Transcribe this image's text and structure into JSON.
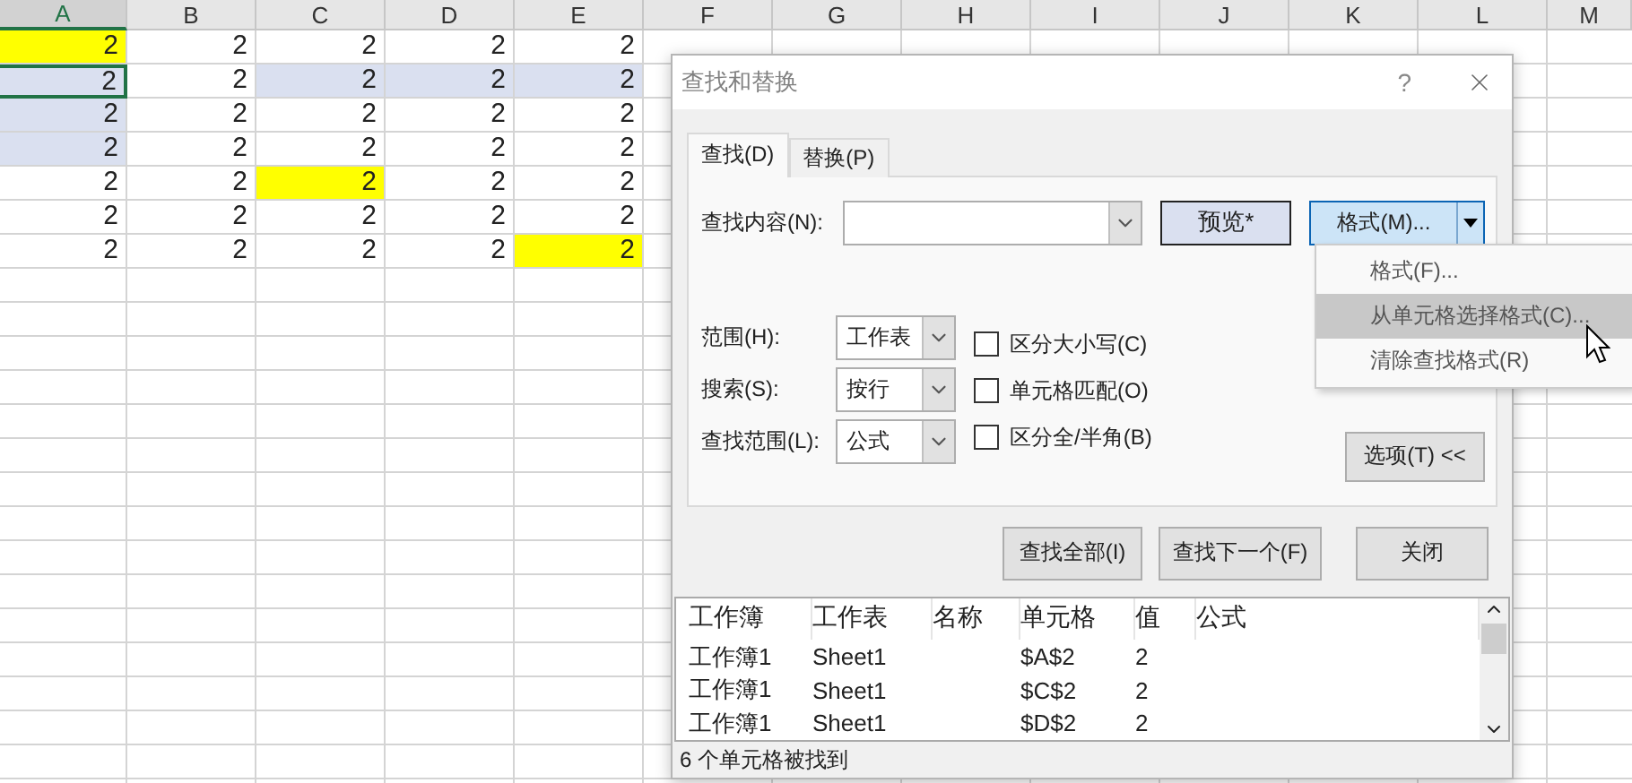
{
  "sheet": {
    "columns": [
      {
        "label": "A",
        "selected": true
      },
      {
        "label": "B",
        "selected": false
      },
      {
        "label": "C",
        "selected": false
      },
      {
        "label": "D",
        "selected": false
      },
      {
        "label": "E",
        "selected": false
      },
      {
        "label": "F",
        "selected": false
      },
      {
        "label": "G",
        "selected": false
      },
      {
        "label": "H",
        "selected": false
      },
      {
        "label": "I",
        "selected": false
      },
      {
        "label": "J",
        "selected": false
      },
      {
        "label": "K",
        "selected": false
      },
      {
        "label": "L",
        "selected": false
      },
      {
        "label": "M",
        "selected": false
      }
    ],
    "rows": [
      {
        "cells": [
          {
            "value": "2",
            "highlighted": true,
            "selected": false,
            "active": false
          },
          {
            "value": "2",
            "highlighted": false,
            "selected": false,
            "active": false
          },
          {
            "value": "2",
            "highlighted": false,
            "selected": false,
            "active": false
          },
          {
            "value": "2",
            "highlighted": false,
            "selected": false,
            "active": false
          },
          {
            "value": "2",
            "highlighted": false,
            "selected": false,
            "active": false
          }
        ]
      },
      {
        "cells": [
          {
            "value": "2",
            "highlighted": false,
            "selected": true,
            "active": true
          },
          {
            "value": "2",
            "highlighted": false,
            "selected": false,
            "active": false
          },
          {
            "value": "2",
            "highlighted": false,
            "selected": true,
            "active": false
          },
          {
            "value": "2",
            "highlighted": false,
            "selected": true,
            "active": false
          },
          {
            "value": "2",
            "highlighted": false,
            "selected": true,
            "active": false
          }
        ]
      },
      {
        "cells": [
          {
            "value": "2",
            "highlighted": false,
            "selected": true,
            "active": false
          },
          {
            "value": "2",
            "highlighted": false,
            "selected": false,
            "active": false
          },
          {
            "value": "2",
            "highlighted": false,
            "selected": false,
            "active": false
          },
          {
            "value": "2",
            "highlighted": false,
            "selected": false,
            "active": false
          },
          {
            "value": "2",
            "highlighted": false,
            "selected": false,
            "active": false
          }
        ]
      },
      {
        "cells": [
          {
            "value": "2",
            "highlighted": false,
            "selected": true,
            "active": false
          },
          {
            "value": "2",
            "highlighted": false,
            "selected": false,
            "active": false
          },
          {
            "value": "2",
            "highlighted": false,
            "selected": false,
            "active": false
          },
          {
            "value": "2",
            "highlighted": false,
            "selected": false,
            "active": false
          },
          {
            "value": "2",
            "highlighted": false,
            "selected": false,
            "active": false
          }
        ]
      },
      {
        "cells": [
          {
            "value": "2",
            "highlighted": false,
            "selected": false,
            "active": false
          },
          {
            "value": "2",
            "highlighted": false,
            "selected": false,
            "active": false
          },
          {
            "value": "2",
            "highlighted": true,
            "selected": false,
            "active": false
          },
          {
            "value": "2",
            "highlighted": false,
            "selected": false,
            "active": false
          },
          {
            "value": "2",
            "highlighted": false,
            "selected": false,
            "active": false
          }
        ]
      },
      {
        "cells": [
          {
            "value": "2",
            "highlighted": false,
            "selected": false,
            "active": false
          },
          {
            "value": "2",
            "highlighted": false,
            "selected": false,
            "active": false
          },
          {
            "value": "2",
            "highlighted": false,
            "selected": false,
            "active": false
          },
          {
            "value": "2",
            "highlighted": false,
            "selected": false,
            "active": false
          },
          {
            "value": "2",
            "highlighted": false,
            "selected": false,
            "active": false
          }
        ]
      },
      {
        "cells": [
          {
            "value": "2",
            "highlighted": false,
            "selected": false,
            "active": false
          },
          {
            "value": "2",
            "highlighted": false,
            "selected": false,
            "active": false
          },
          {
            "value": "2",
            "highlighted": false,
            "selected": false,
            "active": false
          },
          {
            "value": "2",
            "highlighted": false,
            "selected": false,
            "active": false
          },
          {
            "value": "2",
            "highlighted": true,
            "selected": false,
            "active": false
          }
        ]
      }
    ]
  },
  "dialog": {
    "title": "查找和替换",
    "help": "?",
    "tabs": [
      {
        "label": "查找(D)",
        "selected": true
      },
      {
        "label": "替换(P)",
        "selected": false
      }
    ],
    "find_label": "查找内容(N):",
    "preview_button": "预览*",
    "format_button": "格式(M)...",
    "format_menu": [
      {
        "label": "格式(F)...",
        "highlighted": false
      },
      {
        "label": "从单元格选择格式(C)...",
        "highlighted": true
      },
      {
        "label": "清除查找格式(R)",
        "highlighted": false
      }
    ],
    "options": [
      {
        "label": "范围(H):",
        "value": "工作表"
      },
      {
        "label": "搜索(S):",
        "value": "按行"
      },
      {
        "label": "查找范围(L):",
        "value": "公式"
      }
    ],
    "checkboxes": [
      {
        "label": "区分大小写(C)",
        "checked": false
      },
      {
        "label": "单元格匹配(O)",
        "checked": false
      },
      {
        "label": "区分全/半角(B)",
        "checked": false
      }
    ],
    "options_button": "选项(T) <<",
    "buttons": [
      "查找全部(I)",
      "查找下一个(F)",
      "关闭"
    ],
    "results": {
      "columns": [
        "工作簿",
        "工作表",
        "名称",
        "单元格",
        "值",
        "公式"
      ],
      "rows": [
        {
          "workbook": "工作簿1",
          "sheet": "Sheet1",
          "cell": "$A$2",
          "value": "2"
        },
        {
          "workbook": "工作簿1",
          "sheet": "Sheet1",
          "cell": "$C$2",
          "value": "2"
        },
        {
          "workbook": "工作簿1",
          "sheet": "Sheet1",
          "cell": "$D$2",
          "value": "2"
        }
      ]
    },
    "status": "6 个单元格被找到"
  }
}
